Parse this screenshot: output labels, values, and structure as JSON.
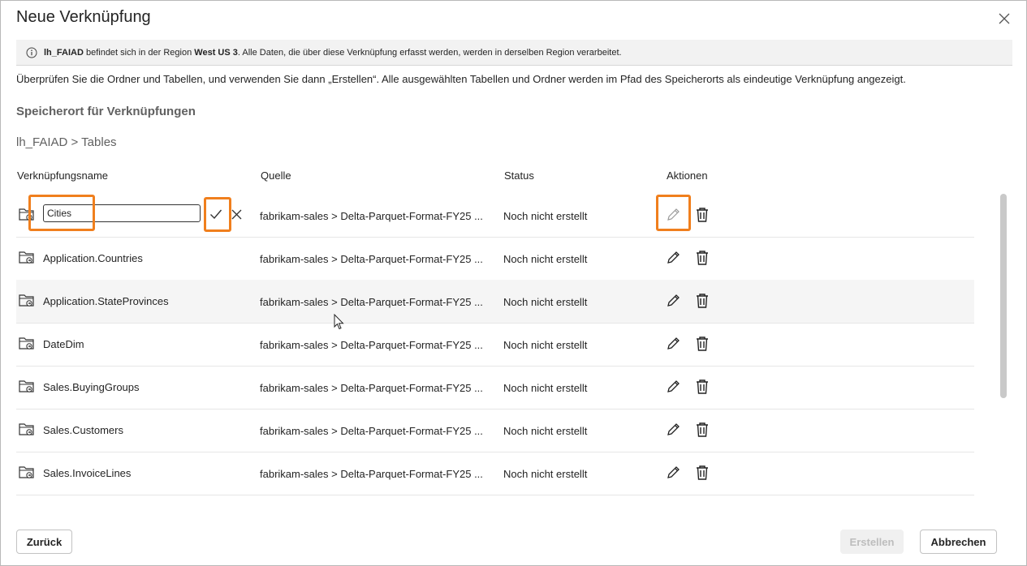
{
  "dialog": {
    "title": "Neue Verknüpfung",
    "info": {
      "lakehouse": "lh_FAIAD",
      "text_before_region": " befindet sich in der Region ",
      "region": "West US 3",
      "text_after_region": ". Alle Daten, die über diese Verknüpfung erfasst werden, werden in derselben Region verarbeitet."
    },
    "description": "Überprüfen Sie die Ordner und Tabellen, und verwenden Sie dann „Erstellen“. Alle ausgewählten Tabellen und Ordner werden im Pfad des Speicherorts als eindeutige Verknüpfung angezeigt.",
    "section_title": "Speicherort für Verknüpfungen",
    "breadcrumb": "lh_FAIAD > Tables"
  },
  "table": {
    "headers": {
      "name": "Verknüpfungsname",
      "source": "Quelle",
      "status": "Status",
      "actions": "Aktionen"
    },
    "editing_value": "Cities",
    "rows": [
      {
        "name": "Cities",
        "source": "fabrikam-sales > Delta-Parquet-Format-FY25 ...",
        "status": "Noch nicht erstellt"
      },
      {
        "name": "Application.Countries",
        "source": "fabrikam-sales > Delta-Parquet-Format-FY25 ...",
        "status": "Noch nicht erstellt"
      },
      {
        "name": "Application.StateProvinces",
        "source": "fabrikam-sales > Delta-Parquet-Format-FY25 ...",
        "status": "Noch nicht erstellt"
      },
      {
        "name": "DateDim",
        "source": "fabrikam-sales > Delta-Parquet-Format-FY25 ...",
        "status": "Noch nicht erstellt"
      },
      {
        "name": "Sales.BuyingGroups",
        "source": "fabrikam-sales > Delta-Parquet-Format-FY25 ...",
        "status": "Noch nicht erstellt"
      },
      {
        "name": "Sales.Customers",
        "source": "fabrikam-sales > Delta-Parquet-Format-FY25 ...",
        "status": "Noch nicht erstellt"
      },
      {
        "name": "Sales.InvoiceLines",
        "source": "fabrikam-sales > Delta-Parquet-Format-FY25 ...",
        "status": "Noch nicht erstellt"
      }
    ]
  },
  "footer": {
    "back_label": "Zurück",
    "create_label": "Erstellen",
    "cancel_label": "Abbrechen"
  },
  "colors": {
    "highlight": "#f07f1d",
    "disabled_button_bg": "#f0f0f0"
  },
  "icons": {
    "close": "close-icon",
    "info": "info-icon",
    "shortcut_folder": "shortcut-folder-icon",
    "edit": "pencil-icon",
    "delete": "trash-icon",
    "confirm": "checkmark-icon",
    "cancel": "close-icon"
  }
}
